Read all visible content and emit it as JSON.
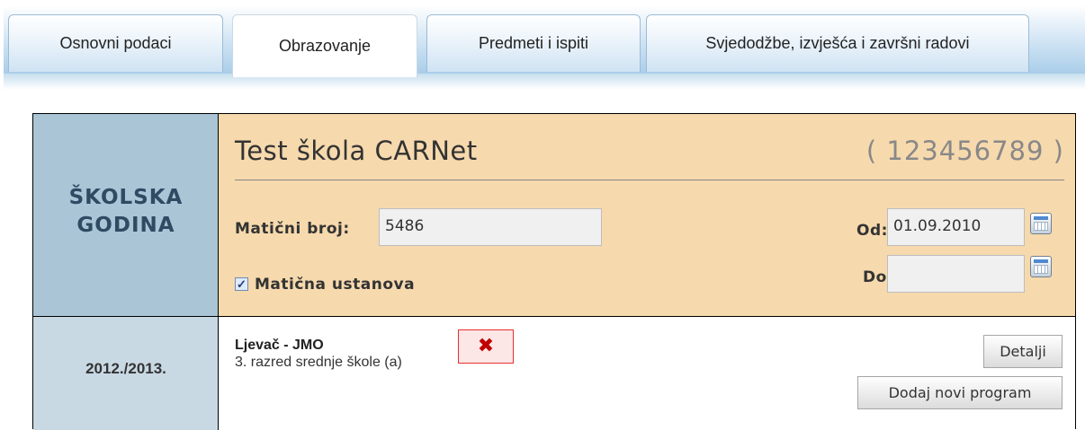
{
  "tabs": [
    {
      "label": "Osnovni podaci",
      "active": false
    },
    {
      "label": "Obrazovanje",
      "active": true
    },
    {
      "label": "Predmeti i ispiti",
      "active": false
    },
    {
      "label": "Svjedodžbe, izvješća i završni radovi",
      "active": false
    }
  ],
  "section_label": "ŠKOLSKA GODINA",
  "school": {
    "name": "Test škola CARNet",
    "code": "( 123456789 )",
    "maticni_broj_label": "Matični broj:",
    "maticni_broj_value": "5486",
    "maticna_ustanova_label": "Matična ustanova",
    "maticna_ustanova_checked": true,
    "od_label": "Od:",
    "od_value": "01.09.2010",
    "do_label": "Do:",
    "do_value": ""
  },
  "year_row": {
    "year": "2012./2013.",
    "program_name": "Ljevač - JMO",
    "program_class": "3. razred srednje škole (a)",
    "delete_symbol": "✖",
    "details_button": "Detalji",
    "add_program_button": "Dodaj novi program"
  },
  "colors": {
    "header_bg": "#f6d9ad",
    "label_bg": "#aac5d6",
    "delete_red": "#c00000"
  }
}
